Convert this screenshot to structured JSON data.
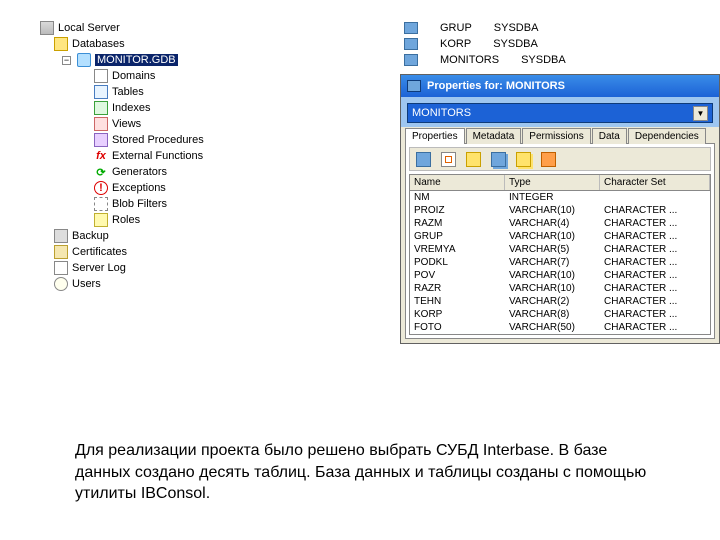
{
  "tree": {
    "root": "Local Server",
    "databases_label": "Databases",
    "dbfile": "MONITOR.GDB",
    "items": [
      "Domains",
      "Tables",
      "Indexes",
      "Views",
      "Stored Procedures",
      "External Functions",
      "Generators",
      "Exceptions",
      "Blob Filters",
      "Roles"
    ],
    "extras": [
      "Backup",
      "Certificates",
      "Server Log",
      "Users"
    ]
  },
  "toplist": [
    {
      "name": "GRUP",
      "owner": "SYSDBA"
    },
    {
      "name": "KORP",
      "owner": "SYSDBA"
    },
    {
      "name": "MONITORS",
      "owner": "SYSDBA"
    }
  ],
  "propwin": {
    "title": "Properties for: MONITORS",
    "combo": "MONITORS",
    "tabs": [
      "Properties",
      "Metadata",
      "Permissions",
      "Data",
      "Dependencies"
    ],
    "grid": {
      "columns": [
        "Name",
        "Type",
        "Character Set"
      ],
      "rows": [
        {
          "n": "NM",
          "t": "INTEGER",
          "c": ""
        },
        {
          "n": "PROIZ",
          "t": "VARCHAR(10)",
          "c": "CHARACTER ..."
        },
        {
          "n": "RAZM",
          "t": "VARCHAR(4)",
          "c": "CHARACTER ..."
        },
        {
          "n": "GRUP",
          "t": "VARCHAR(10)",
          "c": "CHARACTER ..."
        },
        {
          "n": "VREMYA",
          "t": "VARCHAR(5)",
          "c": "CHARACTER ..."
        },
        {
          "n": "PODKL",
          "t": "VARCHAR(7)",
          "c": "CHARACTER ..."
        },
        {
          "n": "POV",
          "t": "VARCHAR(10)",
          "c": "CHARACTER ..."
        },
        {
          "n": "RAZR",
          "t": "VARCHAR(10)",
          "c": "CHARACTER ..."
        },
        {
          "n": "TEHN",
          "t": "VARCHAR(2)",
          "c": "CHARACTER ..."
        },
        {
          "n": "KORP",
          "t": "VARCHAR(8)",
          "c": "CHARACTER ..."
        },
        {
          "n": "FOTO",
          "t": "VARCHAR(50)",
          "c": "CHARACTER ..."
        }
      ]
    }
  },
  "caption": "Для реализации проекта было решено выбрать СУБД Interbase. В базе данных создано десять таблиц. База данных и таблицы созданы с помощью утилиты IBConsol."
}
